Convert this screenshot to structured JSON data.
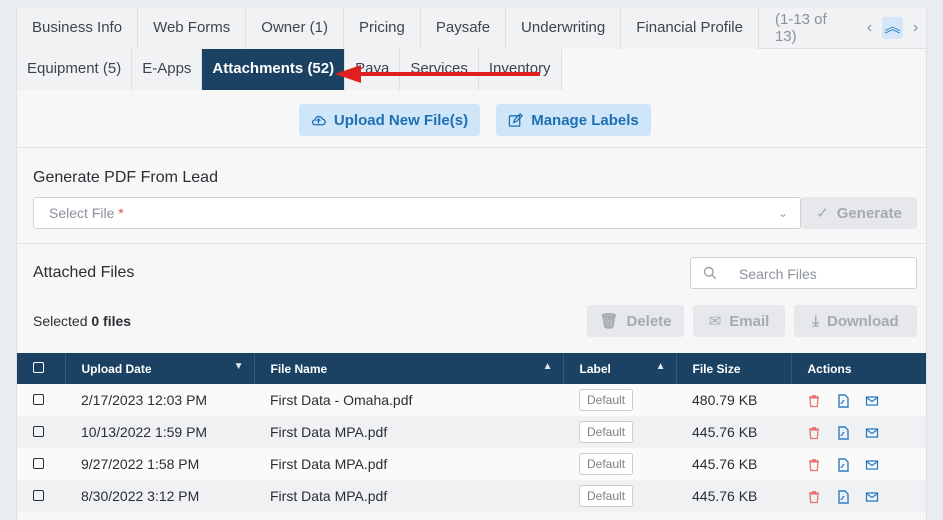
{
  "tabs_row1": [
    {
      "label": "Business Info"
    },
    {
      "label": "Web Forms"
    },
    {
      "label": "Owner (1)"
    },
    {
      "label": "Pricing"
    },
    {
      "label": "Paysafe"
    },
    {
      "label": "Underwriting"
    },
    {
      "label": "Financial Profile"
    }
  ],
  "pager": {
    "count": "(1-13 of 13)",
    "prev": "‹",
    "up": "︽",
    "next": "›"
  },
  "tabs_row2": [
    {
      "label": "Equipment (5)"
    },
    {
      "label": "E-Apps"
    },
    {
      "label": "Attachments (52)"
    },
    {
      "label": "Paya"
    },
    {
      "label": "Services"
    },
    {
      "label": "Inventory"
    }
  ],
  "actions": {
    "upload": "Upload New File(s)",
    "manage": "Manage Labels"
  },
  "generate": {
    "title": "Generate PDF From Lead",
    "select_placeholder": "Select File",
    "required_mark": "*",
    "button": "Generate"
  },
  "attached": {
    "title": "Attached Files",
    "search_placeholder": "Search Files",
    "selected_prefix": "Selected",
    "selected_count": "0 files",
    "delete": "Delete",
    "email": "Email",
    "download": "Download"
  },
  "table": {
    "headers": {
      "date": "Upload Date",
      "name": "File Name",
      "label": "Label",
      "size": "File Size",
      "actions": "Actions"
    },
    "rows": [
      {
        "date": "2/17/2023 12:03 PM",
        "name": "First Data - Omaha.pdf",
        "label": "Default",
        "size": "480.79 KB"
      },
      {
        "date": "10/13/2022 1:59 PM",
        "name": "First Data MPA.pdf",
        "label": "Default",
        "size": "445.76 KB"
      },
      {
        "date": "9/27/2022 1:58 PM",
        "name": "First Data MPA.pdf",
        "label": "Default",
        "size": "445.76 KB"
      },
      {
        "date": "8/30/2022 3:12 PM",
        "name": "First Data MPA.pdf",
        "label": "Default",
        "size": "445.76 KB"
      }
    ]
  },
  "colors": {
    "nav_dark": "#1b4263",
    "accent_blue": "#2e7dc3",
    "light_button": "#cfe6f8",
    "annotation_red": "#e02020",
    "delete_icon": "#e57373"
  }
}
